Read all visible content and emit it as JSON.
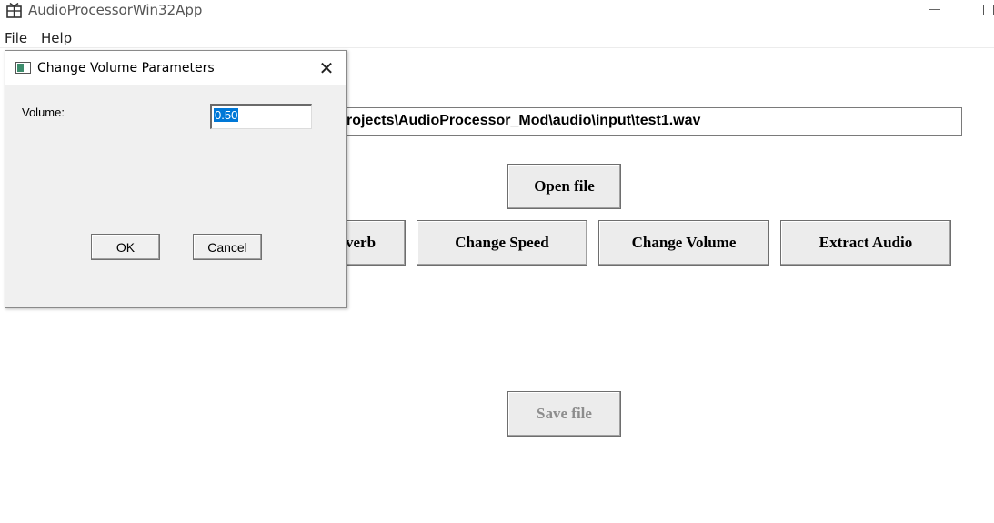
{
  "window": {
    "title": "AudioProcessorWin32App",
    "minimize_icon": "minimize-icon",
    "maximize_icon": "maximize-icon"
  },
  "menu": {
    "items": [
      {
        "label": "File"
      },
      {
        "label": "Help"
      }
    ]
  },
  "main": {
    "file_path": "rojects\\AudioProcessor_Mod\\audio\\input\\test1.wav",
    "open_file_label": "Open file",
    "reverb_label": "verb",
    "change_speed_label": "Change Speed",
    "change_volume_label": "Change Volume",
    "extract_audio_label": "Extract Audio",
    "save_file_label": "Save file"
  },
  "dialog": {
    "title": "Change Volume Parameters",
    "volume_label": "Volume:",
    "volume_value": "0.50",
    "ok_label": "OK",
    "cancel_label": "Cancel",
    "close_icon": "close-icon"
  },
  "colors": {
    "selection": "#0078d7",
    "button_face": "#ececec",
    "dialog_face": "#f0f0f0"
  }
}
